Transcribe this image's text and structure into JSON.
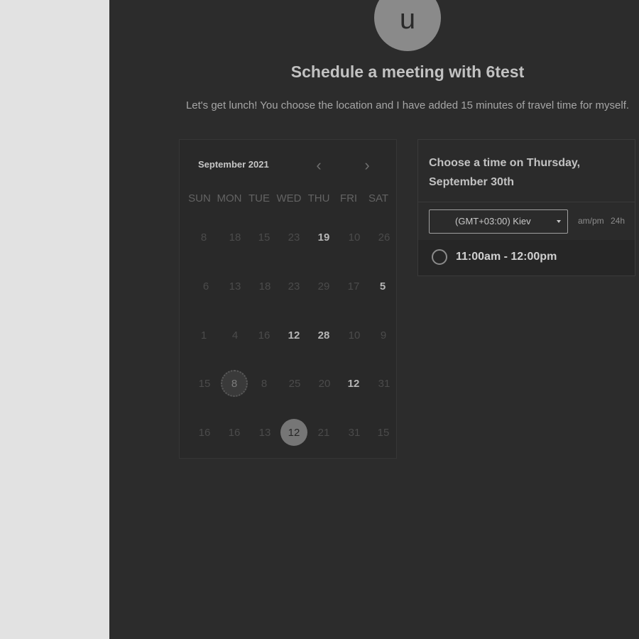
{
  "avatar": {
    "letter": "u"
  },
  "header": {
    "title": "Schedule a meeting with 6test",
    "subtitle": "Let's get lunch! You choose the location and I have added 15 minutes of travel time for myself."
  },
  "calendar": {
    "month_label": "September 2021",
    "prev_icon": "‹",
    "next_icon": "›",
    "weekdays": [
      "SUN",
      "MON",
      "TUE",
      "WED",
      "THU",
      "FRI",
      "SAT"
    ],
    "weeks": [
      [
        "8",
        "18",
        "15",
        "23",
        "19",
        "10",
        "26"
      ],
      [
        "6",
        "13",
        "18",
        "23",
        "29",
        "17",
        "5"
      ],
      [
        "1",
        "4",
        "16",
        "12",
        "28",
        "10",
        "9"
      ],
      [
        "15",
        "8",
        "8",
        "25",
        "20",
        "12",
        "31"
      ],
      [
        "16",
        "16",
        "13",
        "12",
        "21",
        "31",
        "15"
      ]
    ]
  },
  "time_panel": {
    "heading": "Choose a time on Thursday, September 30th",
    "timezone_value": "(GMT+03:00) Kiev",
    "format_ampm": "am/pm",
    "format_24h": "24h",
    "slots": [
      "11:00am - 12:00pm"
    ]
  },
  "colors": {
    "page_background": "#2c2c2c",
    "gutter": "#e2e2e2",
    "selected_day": "#767676"
  }
}
